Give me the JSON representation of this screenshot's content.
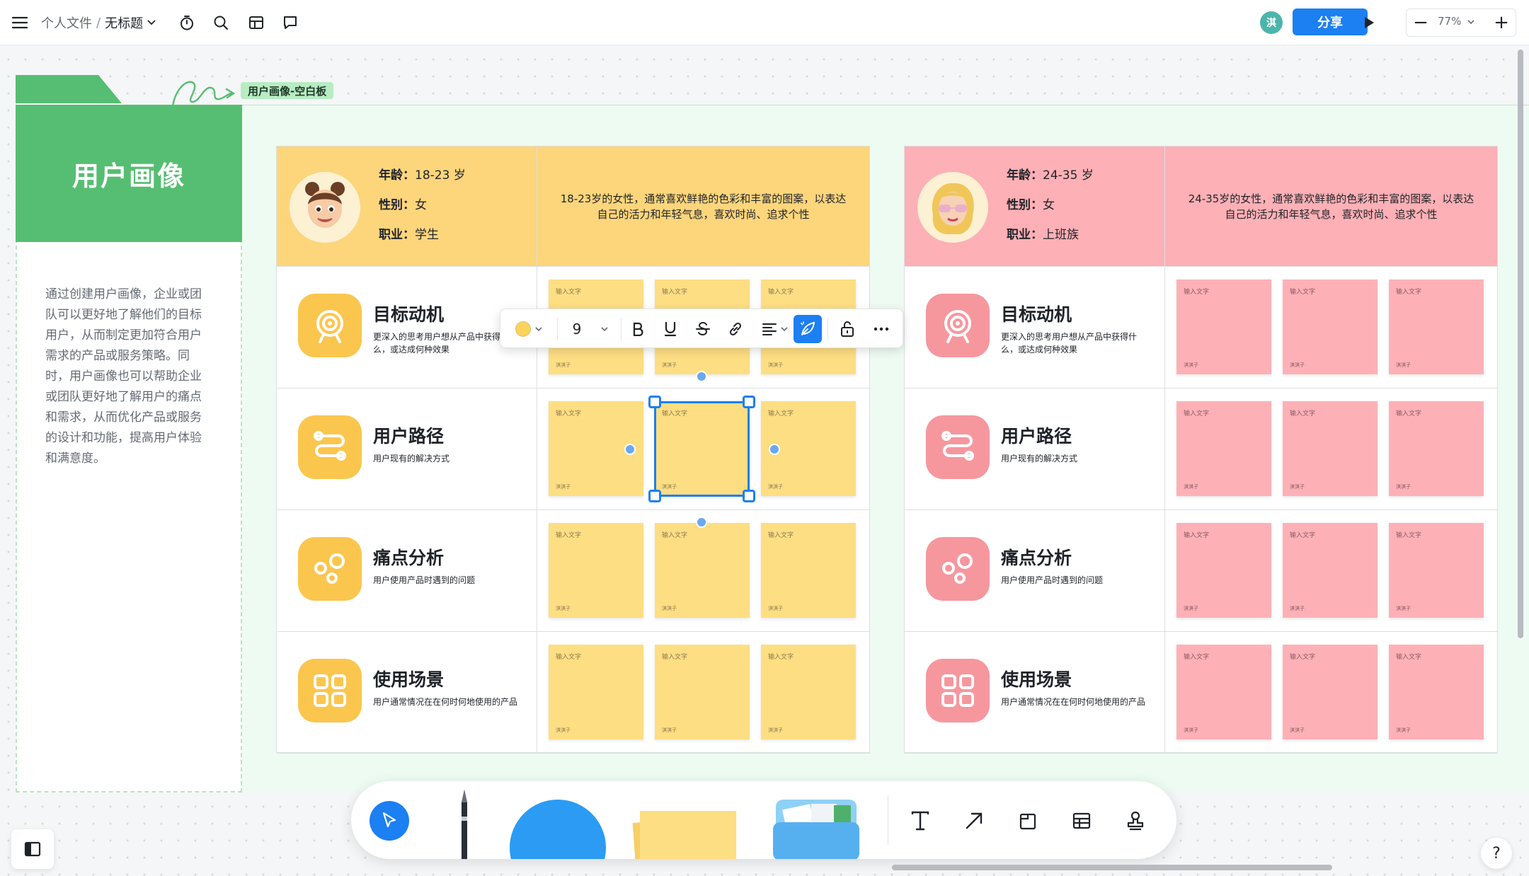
{
  "topbar": {
    "breadcrumb_parent": "个人文件",
    "breadcrumb_sep": "/",
    "doc_title": "无标题",
    "avatar_initial": "淇",
    "share_label": "分享",
    "zoom_minus": "−",
    "zoom_value": "77%",
    "zoom_plus": "+"
  },
  "frame": {
    "label": "用户画像-空白板",
    "panel_title": "用户画像",
    "panel_description": "通过创建用户画像，企业或团队可以更好地了解他们的目标用户，从而制定更加符合用户需求的产品或服务策略。同时，用户画像也可以帮助企业或团队更好地了解用户的痛点和需求，从而优化产品或服务的设计和功能，提高用户体验和满意度。"
  },
  "labels": {
    "age": "年龄：",
    "gender": "性别：",
    "job": "职业："
  },
  "personas": [
    {
      "age": "18-23 岁",
      "gender": "女",
      "job": "学生",
      "description": "18-23岁的女性，通常喜欢鲜艳的色彩和丰富的图案，以表达自己的活力和年轻气息，喜欢时尚、追求个性",
      "accent": "#fbc64e",
      "header_bg": "#fdd57b",
      "sticky_bg": "#fede82",
      "dims": [
        {
          "title": "目标动机",
          "desc": "更深入的思考用户想从产品中获得什么，或达成何种效果",
          "icon": "target-icon"
        },
        {
          "title": "用户路径",
          "desc": "用户现有的解决方式",
          "icon": "route-icon"
        },
        {
          "title": "痛点分析",
          "desc": "用户使用产品时遇到的问题",
          "icon": "bubbles-icon"
        },
        {
          "title": "使用场景",
          "desc": "用户通常情况在在何时何地使用的产品",
          "icon": "grid-icon"
        }
      ]
    },
    {
      "age": "24-35 岁",
      "gender": "女",
      "job": "上班族",
      "description": "24-35岁的女性，通常喜欢鲜艳的色彩和丰富的图案，以表达自己的活力和年轻气息，喜欢时尚、追求个性",
      "accent": "#f6979e",
      "header_bg": "#fdb0b5",
      "sticky_bg": "#fdb1b7",
      "dims": [
        {
          "title": "目标动机",
          "desc": "更深入的思考用户想从产品中获得什么，或达成何种效果",
          "icon": "target-icon"
        },
        {
          "title": "用户路径",
          "desc": "用户现有的解决方式",
          "icon": "route-icon"
        },
        {
          "title": "痛点分析",
          "desc": "用户使用产品时遇到的问题",
          "icon": "bubbles-icon"
        },
        {
          "title": "使用场景",
          "desc": "用户通常情况在在何时何地使用的产品",
          "icon": "grid-icon"
        }
      ]
    }
  ],
  "sticky": {
    "placeholder": "输入文字",
    "author": "淇淇子"
  },
  "format_toolbar": {
    "font_size": "9",
    "fill_color": "#fbd35a"
  },
  "colors": {
    "brand_green": "#56be72",
    "selection_blue": "#1c7ff2"
  }
}
